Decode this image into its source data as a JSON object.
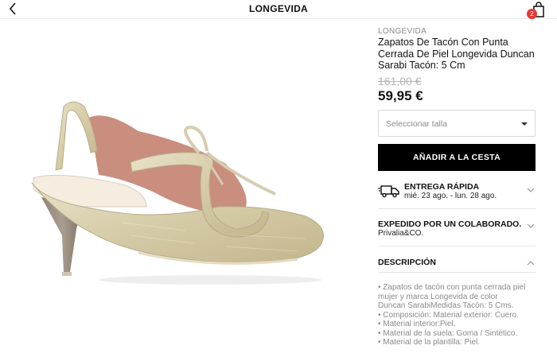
{
  "header": {
    "title": "LONGEVIDA",
    "cart_count": "2"
  },
  "product": {
    "brand": "LONGEVIDA",
    "name": "Zapatos De Tacón Con Punta Cerrada De Piel Longevida Duncan Sarabi Tacón: 5 Cm",
    "old_price": "161,00 €",
    "price": "59,95 €",
    "image_icon": "beige-slingback-shoe-photo"
  },
  "size_select": {
    "placeholder": "Seleccionar talla"
  },
  "add_to_cart": {
    "label": "AÑADIR A LA CESTA"
  },
  "delivery": {
    "title": "ENTREGA RÁPIDA",
    "dates": "mié. 23 ago. - lun. 28 ago."
  },
  "seller": {
    "title": "EXPEDIDO POR UN COLABORADO...",
    "name": "Privalia&CO."
  },
  "description": {
    "title": "DESCRIPCIÓN",
    "lines": [
      "• Zapatos de tacón con punta cerrada piel",
      "mujer y marca Longevida de color",
      "Duncan SarabiMedidas Tacón: 5 Cms.",
      "• Composición: Material exterior: Cuero.",
      "• Material interior:Piel.",
      "• Material de la suela: Goma / Sintético.",
      "• Material de la plantilla: Piel."
    ]
  },
  "colors": {
    "accent_button": "#000000",
    "badge": "#e53935",
    "muted_text": "#8a8a8a"
  }
}
